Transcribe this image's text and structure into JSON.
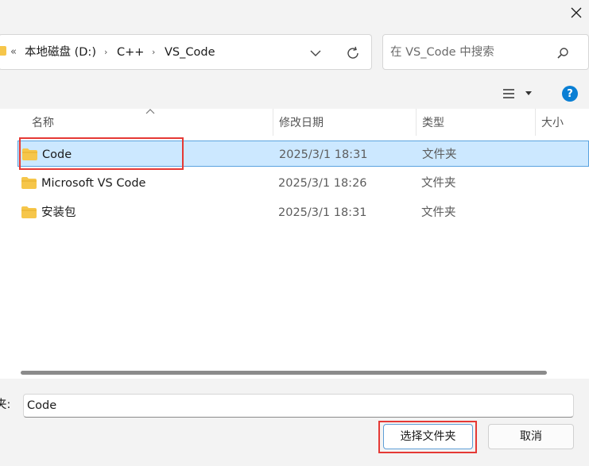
{
  "address": {
    "overflow_glyph": "«",
    "breadcrumbs": [
      "本地磁盘 (D:)",
      "C++",
      "VS_Code"
    ],
    "separator": "›"
  },
  "search": {
    "placeholder": "在 VS_Code 中搜索"
  },
  "toolbar": {
    "help_glyph": "?"
  },
  "columns": {
    "name": "名称",
    "modified": "修改日期",
    "type": "类型",
    "size": "大小"
  },
  "files": [
    {
      "name": "Code",
      "modified": "2025/3/1 18:31",
      "type": "文件夹",
      "selected": true
    },
    {
      "name": "Microsoft VS Code",
      "modified": "2025/3/1 18:26",
      "type": "文件夹",
      "selected": false
    },
    {
      "name": "安装包",
      "modified": "2025/3/1 18:31",
      "type": "文件夹",
      "selected": false
    }
  ],
  "folder_field": {
    "label": "夹:",
    "value": "Code"
  },
  "buttons": {
    "select": "选择文件夹",
    "cancel": "取消"
  },
  "colors": {
    "selection": "#cce8ff",
    "highlight": "#e53935",
    "folder": "#f6c64a",
    "accent": "#0a7fd4"
  }
}
